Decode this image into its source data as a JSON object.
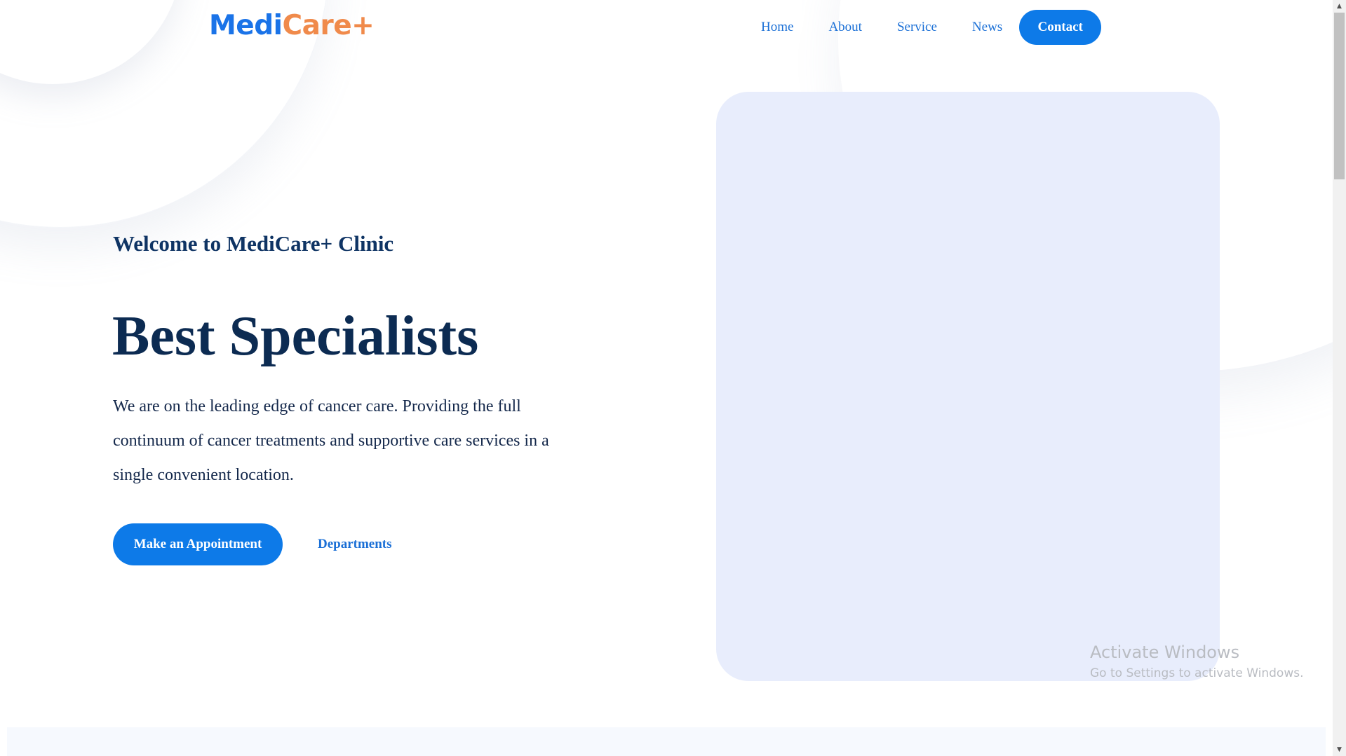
{
  "header": {
    "logo": {
      "part1": "MediCare",
      "part2": "+"
    },
    "logo_full": "MediCare+",
    "nav": [
      {
        "label": "Home"
      },
      {
        "label": "About"
      },
      {
        "label": "Service"
      },
      {
        "label": "News"
      }
    ],
    "contact_label": "Contact"
  },
  "hero": {
    "welcome": "Welcome to MediCare+ Clinic",
    "headline": "Best Specialists",
    "description": "We are on the leading edge of cancer care. Providing the full continuum of cancer treatments and supportive care services in a single convenient location.",
    "primary_button": "Make an Appointment",
    "secondary_button": "Departments"
  },
  "watermark": {
    "title": "Activate Windows",
    "subtitle": "Go to Settings to activate Windows."
  },
  "colors": {
    "brand_blue": "#0d7ae8",
    "brand_orange": "#f08a4b",
    "heading_navy": "#0c2b52",
    "image_placeholder": "#e8edfc"
  }
}
